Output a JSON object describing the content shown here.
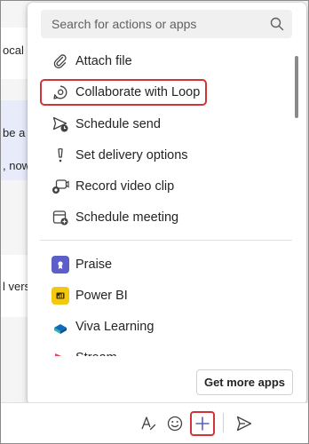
{
  "background_messages": [
    {
      "text": "ocal"
    },
    {
      "text": "be a"
    },
    {
      "text": ", now"
    },
    {
      "text": "l vers"
    }
  ],
  "popup": {
    "search": {
      "placeholder": "Search for actions or apps"
    },
    "actions": [
      {
        "label": "Attach file",
        "icon": "paperclip-icon"
      },
      {
        "label": "Collaborate with Loop",
        "icon": "loop-icon",
        "highlighted": true
      },
      {
        "label": "Schedule send",
        "icon": "schedule-send-icon"
      },
      {
        "label": "Set delivery options",
        "icon": "delivery-options-icon"
      },
      {
        "label": "Record video clip",
        "icon": "video-clip-icon"
      },
      {
        "label": "Schedule meeting",
        "icon": "schedule-meeting-icon"
      }
    ],
    "apps": [
      {
        "label": "Praise",
        "icon": "praise-icon",
        "color": "#5b5fc7"
      },
      {
        "label": "Power BI",
        "icon": "power-bi-icon",
        "color": "#f2c811"
      },
      {
        "label": "Viva Learning",
        "icon": "viva-learning-icon",
        "color": "#0f6cbd"
      },
      {
        "label": "Stream",
        "icon": "stream-icon",
        "color": "#e8455a"
      }
    ],
    "get_more_apps_label": "Get more apps"
  },
  "compose_bar": {
    "tools": [
      "format-icon",
      "emoji-icon",
      "plus-icon",
      "send-icon"
    ],
    "highlight_color": "#d13438"
  }
}
